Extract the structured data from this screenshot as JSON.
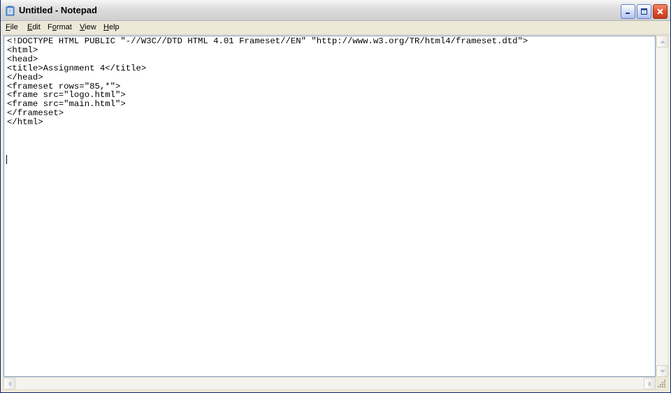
{
  "window": {
    "title": "Untitled - Notepad",
    "app_icon": "notepad-icon",
    "controls": {
      "minimize": "minimize-icon",
      "maximize": "maximize-icon",
      "close": "close-icon"
    }
  },
  "menu": {
    "items": [
      {
        "label": "File",
        "accel": "F",
        "rest": "ile"
      },
      {
        "label": "Edit",
        "accel": "E",
        "rest": "dit"
      },
      {
        "label": "Format",
        "accel": "o",
        "pre": "F",
        "rest": "rmat"
      },
      {
        "label": "View",
        "accel": "V",
        "rest": "iew"
      },
      {
        "label": "Help",
        "accel": "H",
        "rest": "elp"
      }
    ]
  },
  "editor": {
    "text": "<!DOCTYPE HTML PUBLIC \"-//W3C//DTD HTML 4.01 Frameset//EN\" \"http://www.w3.org/TR/html4/frameset.dtd\">\n<html>\n<head>\n<title>Assignment 4</title>\n</head>\n<frameset rows=\"85,*\">\n<frame src=\"logo.html\">\n<frame src=\"main.html\">\n</frameset>\n</html>"
  },
  "colors": {
    "close_button": "#e0502c",
    "editor_background": "#ffffff",
    "chrome": "#ece9d8"
  }
}
